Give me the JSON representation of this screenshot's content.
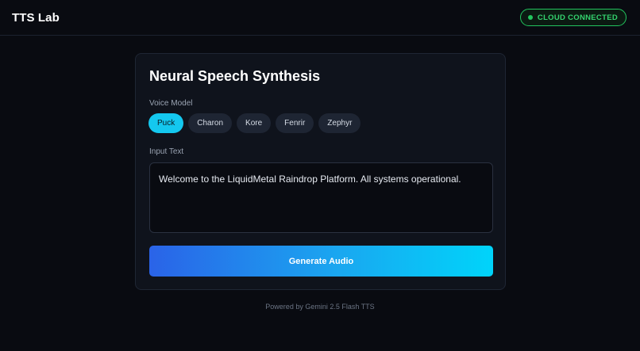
{
  "app": {
    "title": "TTS Lab"
  },
  "status": {
    "label": "CLOUD CONNECTED",
    "color": "#22c55e",
    "icon": "status-dot-icon"
  },
  "card": {
    "title": "Neural Speech Synthesis",
    "voice_label": "Voice Model",
    "voices": [
      {
        "label": "Puck",
        "selected": true
      },
      {
        "label": "Charon",
        "selected": false
      },
      {
        "label": "Kore",
        "selected": false
      },
      {
        "label": "Fenrir",
        "selected": false
      },
      {
        "label": "Zephyr",
        "selected": false
      }
    ],
    "input_label": "Input Text",
    "input_value": "Welcome to the LiquidMetal Raindrop Platform. All systems operational.",
    "generate_label": "Generate Audio"
  },
  "footer": {
    "text": "Powered by Gemini 2.5 Flash TTS"
  },
  "colors": {
    "accent": "#14c8ef",
    "background": "#090b11"
  }
}
